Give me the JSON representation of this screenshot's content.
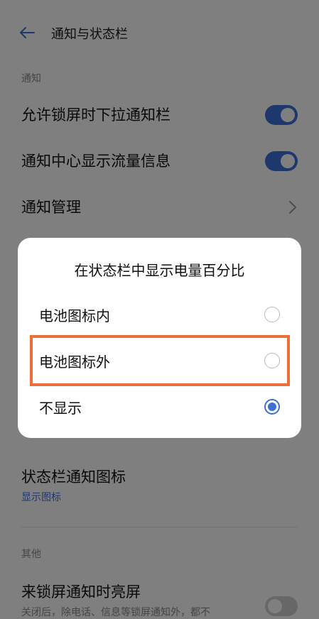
{
  "header": {
    "title": "通知与状态栏",
    "back_icon": "arrow-left-icon"
  },
  "sections": {
    "notifications_label": "通知",
    "other_label": "其他"
  },
  "rows": {
    "lockscreen_pulldown": {
      "label": "允许锁屏时下拉通知栏",
      "enabled": true
    },
    "traffic_info": {
      "label": "通知中心显示流量信息",
      "enabled": true
    },
    "notification_mgmt": {
      "label": "通知管理"
    },
    "statusbar_icons": {
      "label": "状态栏通知图标",
      "value": "显示图标"
    },
    "wake_on_lock_notif": {
      "label": "来锁屏通知时亮屏",
      "desc": "关闭后，除电话、信息等锁屏通知外，都不",
      "enabled": false
    }
  },
  "dialog": {
    "title": "在状态栏中显示电量百分比",
    "options": [
      {
        "label": "电池图标内",
        "selected": false
      },
      {
        "label": "电池图标外",
        "selected": false
      },
      {
        "label": "不显示",
        "selected": true
      }
    ]
  },
  "colors": {
    "accent": "#3d6fd8",
    "highlight": "#ee6e3a"
  }
}
